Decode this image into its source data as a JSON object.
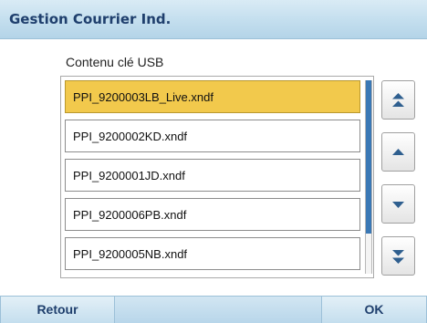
{
  "header": {
    "title": "Gestion Courrier Ind."
  },
  "content": {
    "label": "Contenu clé USB",
    "files": [
      {
        "name": "PPI_9200003LB_Live.xndf",
        "selected": true
      },
      {
        "name": "PPI_9200002KD.xndf",
        "selected": false
      },
      {
        "name": "PPI_9200001JD.xndf",
        "selected": false
      },
      {
        "name": "PPI_9200006PB.xndf",
        "selected": false
      },
      {
        "name": "PPI_9200005NB.xndf",
        "selected": false
      }
    ]
  },
  "scroll_buttons": {
    "top": "double-chevron-up-icon",
    "up": "chevron-up-icon",
    "down": "chevron-down-icon",
    "bottom": "double-chevron-down-icon"
  },
  "footer": {
    "back_label": "Retour",
    "ok_label": "OK"
  },
  "colors": {
    "selected_item": "#f2c94c",
    "title_text": "#1f3f6d",
    "scroll_thumb": "#3a78b5"
  }
}
